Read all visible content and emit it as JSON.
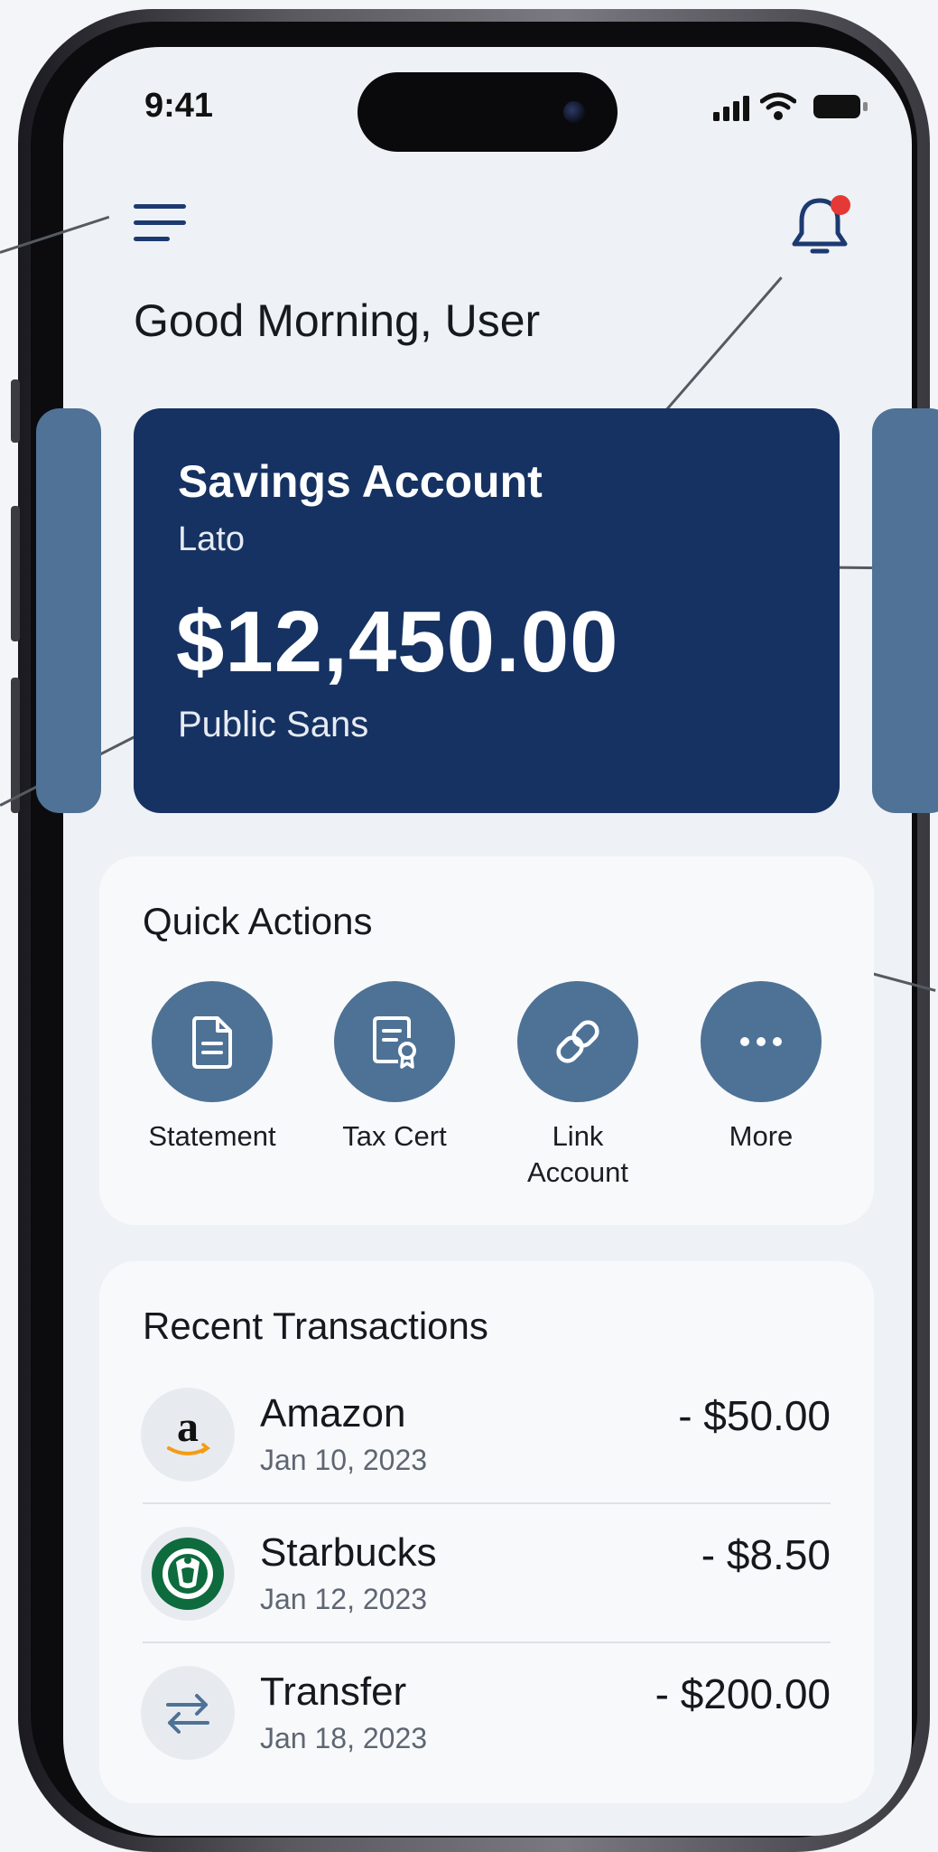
{
  "status_bar": {
    "time": "9:41"
  },
  "header": {
    "greeting": "Good Morning, User"
  },
  "account_card": {
    "title": "Savings Account",
    "title_font": "Lato",
    "balance": "$12,450.00",
    "balance_font": "Public Sans"
  },
  "notification": {
    "has_unread": true,
    "dot_color": "#e53935"
  },
  "quick_actions": {
    "title": "Quick Actions",
    "items": [
      {
        "label": "Statement",
        "icon": "document-icon"
      },
      {
        "label": "Tax Cert",
        "icon": "certificate-icon"
      },
      {
        "label": "Link",
        "label2": "Account",
        "icon": "link-icon"
      },
      {
        "label": "More",
        "icon": "more-icon"
      }
    ]
  },
  "recent_transactions": {
    "title": "Recent Transactions",
    "items": [
      {
        "name": "Amazon",
        "date": "Jan 10, 2023",
        "amount": "- $50.00",
        "icon": "amazon-logo"
      },
      {
        "name": "Starbucks",
        "date": "Jan 12, 2023",
        "amount": "- $8.50",
        "icon": "starbucks-logo"
      },
      {
        "name": "Transfer",
        "date": "Jan 18, 2023",
        "amount": "- $200.00",
        "icon": "transfer-icon"
      }
    ]
  },
  "colors": {
    "primary_navy": "#163262",
    "accent_blue": "#4e7296",
    "background": "#eef1f5"
  }
}
